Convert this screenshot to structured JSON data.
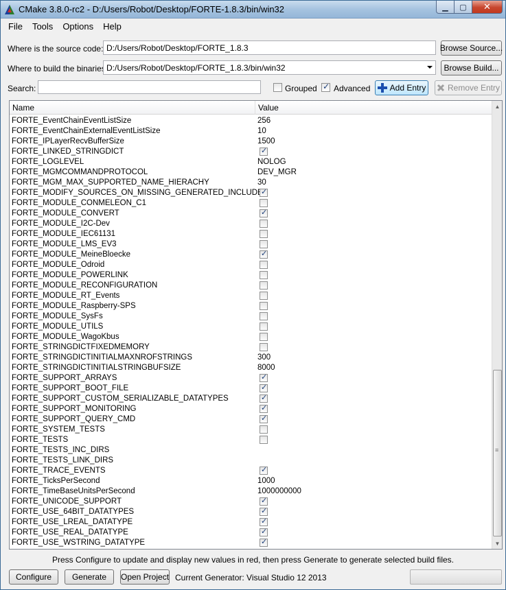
{
  "window": {
    "title": "CMake 3.8.0-rc2 - D:/Users/Robot/Desktop/FORTE-1.8.3/bin/win32"
  },
  "menu": [
    "File",
    "Tools",
    "Options",
    "Help"
  ],
  "source": {
    "label": "Where is the source code:",
    "value": "D:/Users/Robot/Desktop/FORTE_1.8.3",
    "button": "Browse Source..."
  },
  "build": {
    "label": "Where to build the binaries:",
    "value": "D:/Users/Robot/Desktop/FORTE_1.8.3/bin/win32",
    "button": "Browse Build..."
  },
  "search": {
    "label": "Search:",
    "value": ""
  },
  "options": {
    "grouped_label": "Grouped",
    "grouped": false,
    "advanced_label": "Advanced",
    "advanced": true
  },
  "actions": {
    "add_entry": "Add Entry",
    "remove_entry": "Remove Entry"
  },
  "table": {
    "columns": [
      "Name",
      "Value"
    ],
    "rows": [
      {
        "name": "FORTE_EventChainEventListSize",
        "value": "256"
      },
      {
        "name": "FORTE_EventChainExternalEventListSize",
        "value": "10"
      },
      {
        "name": "FORTE_IPLayerRecvBufferSize",
        "value": "1500"
      },
      {
        "name": "FORTE_LINKED_STRINGDICT",
        "checked": true
      },
      {
        "name": "FORTE_LOGLEVEL",
        "value": "NOLOG"
      },
      {
        "name": "FORTE_MGMCOMMANDPROTOCOL",
        "value": "DEV_MGR"
      },
      {
        "name": "FORTE_MGM_MAX_SUPPORTED_NAME_HIERACHY",
        "value": "30"
      },
      {
        "name": "FORTE_MODIFY_SOURCES_ON_MISSING_GENERATED_INCLUDES",
        "checked": true
      },
      {
        "name": "FORTE_MODULE_CONMELEON_C1",
        "checked": false
      },
      {
        "name": "FORTE_MODULE_CONVERT",
        "checked": true
      },
      {
        "name": "FORTE_MODULE_I2C-Dev",
        "checked": false
      },
      {
        "name": "FORTE_MODULE_IEC61131",
        "checked": false
      },
      {
        "name": "FORTE_MODULE_LMS_EV3",
        "checked": false
      },
      {
        "name": "FORTE_MODULE_MeineBloecke",
        "checked": true
      },
      {
        "name": "FORTE_MODULE_Odroid",
        "checked": false
      },
      {
        "name": "FORTE_MODULE_POWERLINK",
        "checked": false
      },
      {
        "name": "FORTE_MODULE_RECONFIGURATION",
        "checked": false
      },
      {
        "name": "FORTE_MODULE_RT_Events",
        "checked": false
      },
      {
        "name": "FORTE_MODULE_Raspberry-SPS",
        "checked": false
      },
      {
        "name": "FORTE_MODULE_SysFs",
        "checked": false
      },
      {
        "name": "FORTE_MODULE_UTILS",
        "checked": false
      },
      {
        "name": "FORTE_MODULE_WagoKbus",
        "checked": false
      },
      {
        "name": "FORTE_STRINGDICTFIXEDMEMORY",
        "checked": false
      },
      {
        "name": "FORTE_STRINGDICTINITIALMAXNROFSTRINGS",
        "value": "300"
      },
      {
        "name": "FORTE_STRINGDICTINITIALSTRINGBUFSIZE",
        "value": "8000"
      },
      {
        "name": "FORTE_SUPPORT_ARRAYS",
        "checked": true
      },
      {
        "name": "FORTE_SUPPORT_BOOT_FILE",
        "checked": true
      },
      {
        "name": "FORTE_SUPPORT_CUSTOM_SERIALIZABLE_DATATYPES",
        "checked": true
      },
      {
        "name": "FORTE_SUPPORT_MONITORING",
        "checked": true
      },
      {
        "name": "FORTE_SUPPORT_QUERY_CMD",
        "checked": true
      },
      {
        "name": "FORTE_SYSTEM_TESTS",
        "checked": false
      },
      {
        "name": "FORTE_TESTS",
        "checked": false
      },
      {
        "name": "FORTE_TESTS_INC_DIRS",
        "value": ""
      },
      {
        "name": "FORTE_TESTS_LINK_DIRS",
        "value": ""
      },
      {
        "name": "FORTE_TRACE_EVENTS",
        "checked": true
      },
      {
        "name": "FORTE_TicksPerSecond",
        "value": "1000"
      },
      {
        "name": "FORTE_TimeBaseUnitsPerSecond",
        "value": "1000000000"
      },
      {
        "name": "FORTE_UNICODE_SUPPORT",
        "checked": true
      },
      {
        "name": "FORTE_USE_64BIT_DATATYPES",
        "checked": true
      },
      {
        "name": "FORTE_USE_LREAL_DATATYPE",
        "checked": true
      },
      {
        "name": "FORTE_USE_REAL_DATATYPE",
        "checked": true
      },
      {
        "name": "FORTE_USE_WSTRING_DATATYPE",
        "checked": true
      }
    ]
  },
  "hint": "Press Configure to update and display new values in red, then press Generate to generate selected build files.",
  "bottom": {
    "configure": "Configure",
    "generate": "Generate",
    "open_project": "Open Project",
    "generator": "Current Generator: Visual Studio 12 2013",
    "progress": 0
  }
}
